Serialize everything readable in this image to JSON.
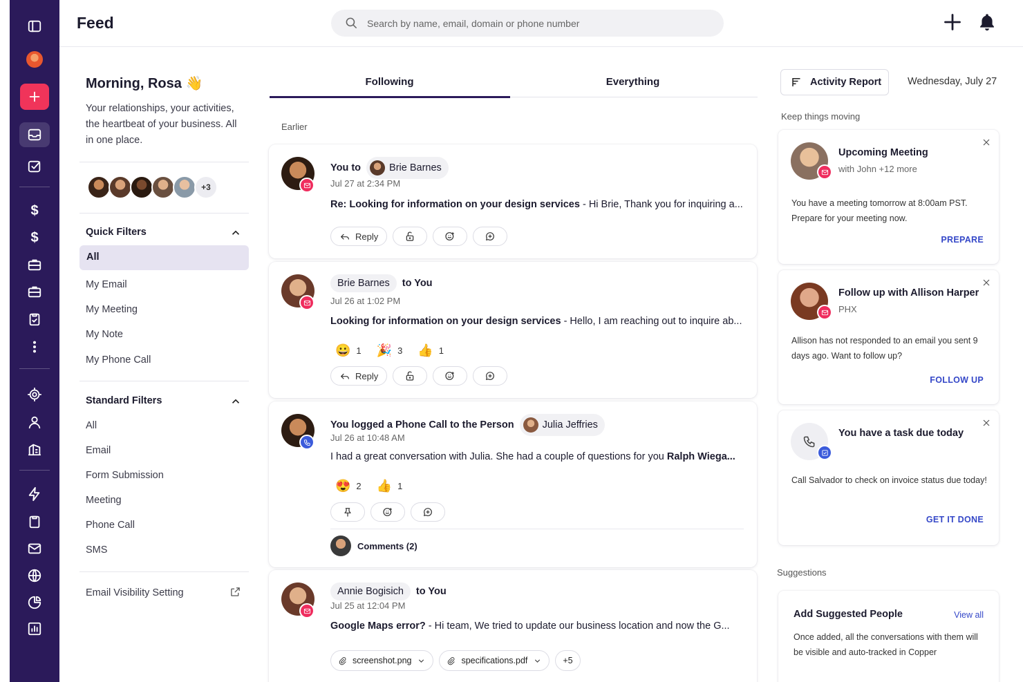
{
  "header": {
    "title": "Feed",
    "search_placeholder": "Search by name, email, domain or phone number"
  },
  "rail": {
    "icons": [
      "sidebar-toggle-icon",
      "user-avatar",
      "add-icon",
      "inbox-icon",
      "tasks-icon",
      "dollar-icon",
      "dollar-icon",
      "briefcase-icon",
      "briefcase-icon",
      "clipboard-check-icon",
      "more-vertical-icon",
      "target-icon",
      "person-icon",
      "building-icon",
      "bolt-icon",
      "clipboard-icon",
      "mail-icon",
      "globe-icon",
      "pie-chart-icon",
      "bar-chart-icon"
    ],
    "colors": {
      "background": "#2b1a5a",
      "accent": "#f0345a"
    }
  },
  "welcome": {
    "greeting": "Morning, Rosa 👋",
    "description": "Your relationships, your activities, the heartbeat of your business. All in one place.",
    "avatars_more": "+3"
  },
  "quick_filters": {
    "heading": "Quick Filters",
    "items": [
      "All",
      "My Email",
      "My Meeting",
      "My Note",
      "My Phone Call"
    ],
    "selected": "All"
  },
  "standard_filters": {
    "heading": "Standard Filters",
    "items": [
      "All",
      "Email",
      "Form Submission",
      "Meeting",
      "Phone Call",
      "SMS"
    ]
  },
  "email_visibility": "Email Visibility Setting",
  "feed": {
    "tabs": [
      "Following",
      "Everything"
    ],
    "active_tab": "Following",
    "section_label": "Earlier",
    "reply_label": "Reply",
    "items": [
      {
        "prefix": "You to",
        "person": "Brie Barnes",
        "time": "Jul 27 at 2:34 PM",
        "subject": "Re: Looking for information on your design services",
        "snippet": " - Hi Brie,  Thank you for inquiring a..."
      },
      {
        "person": "Brie Barnes",
        "suffix": "to You",
        "time": "Jul 26 at 1:02 PM",
        "subject": "Looking for information on your design services",
        "snippet": " - Hello, I am reaching out to inquire ab...",
        "reactions": [
          {
            "emoji": "😀",
            "count": "1"
          },
          {
            "emoji": "🎉",
            "count": "3"
          },
          {
            "emoji": "👍",
            "count": "1"
          }
        ]
      },
      {
        "prefix": "You logged a Phone Call to the Person",
        "person": "Julia Jeffries",
        "time": "Jul 26 at 10:48 AM",
        "text": "I had a great conversation with Julia. She had a couple of questions for you ",
        "text_bold": "Ralph Wiega...",
        "reactions": [
          {
            "emoji": "😍",
            "count": "2"
          },
          {
            "emoji": "👍",
            "count": "1"
          }
        ],
        "comments": "Comments (2)"
      },
      {
        "person": "Annie Bogisich",
        "suffix": "to You",
        "time": "Jul 25 at 12:04 PM",
        "subject": "Google Maps error?",
        "snippet": " - Hi team, We tried to update our business location and now the G...",
        "attachments": [
          "screenshot.png",
          "specifications.pdf"
        ],
        "attachments_more": "+5"
      }
    ]
  },
  "right": {
    "activity_report": "Activity Report",
    "date": "Wednesday, July 27",
    "keep_moving": "Keep things moving",
    "cards": [
      {
        "title": "Upcoming Meeting",
        "subtitle": "with John +12 more",
        "text": "You have a meeting tomorrow at 8:00am PST. Prepare for your meeting now.",
        "cta": "PREPARE"
      },
      {
        "title": "Follow up with Allison Harper",
        "subtitle": "PHX",
        "text": "Allison has not responded to an email you sent 9 days ago. Want to follow up?",
        "cta": "FOLLOW UP"
      },
      {
        "title": "You have a task due today",
        "text": "Call Salvador to check on invoice status due today!",
        "cta": "GET IT DONE"
      }
    ],
    "suggestions_label": "Suggestions",
    "suggest_title": "Add Suggested People",
    "view_all": "View all",
    "suggest_text": "Once added, all the conversations with them will be visible and auto-tracked in Copper"
  }
}
